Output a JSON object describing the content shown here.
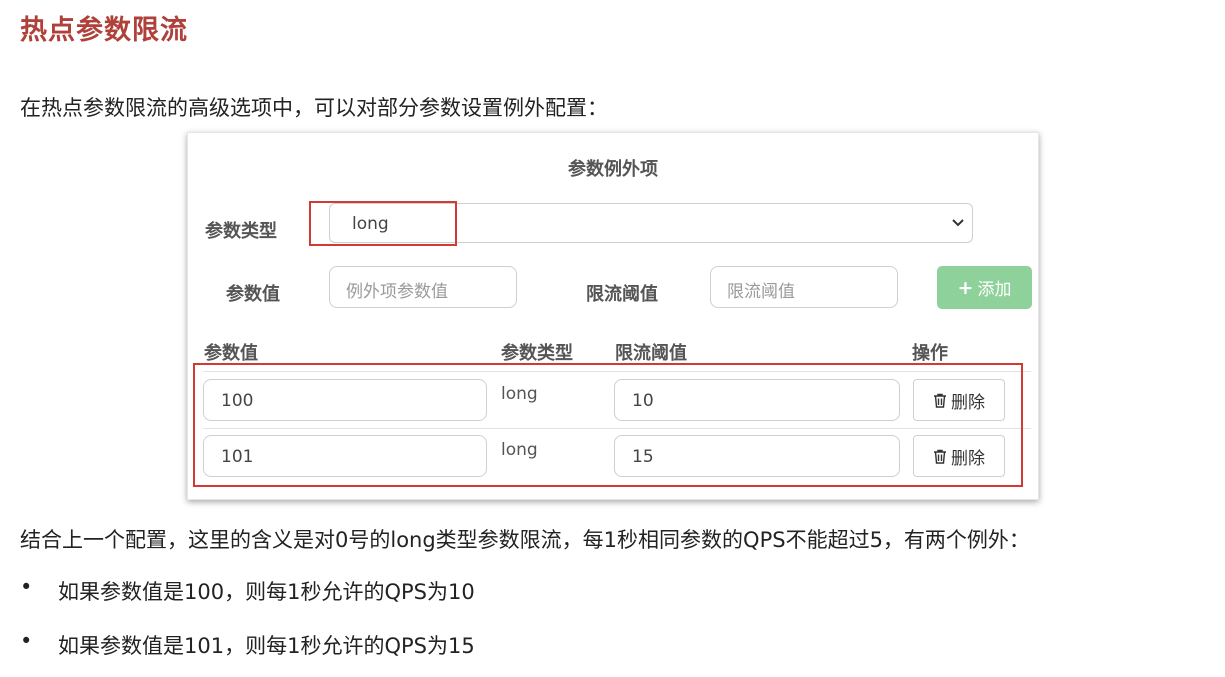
{
  "heading": "热点参数限流",
  "intro": "在热点参数限流的高级选项中，可以对部分参数设置例外配置：",
  "panel": {
    "title": "参数例外项",
    "param_type_label": "参数类型",
    "param_type_value": "long",
    "param_value_label": "参数值",
    "param_value_placeholder": "例外项参数值",
    "threshold_label": "限流阈值",
    "threshold_placeholder": "限流阈值",
    "add_button": "添加",
    "table": {
      "headers": [
        "参数值",
        "参数类型",
        "限流阈值",
        "操作"
      ],
      "rows": [
        {
          "value": "100",
          "type": "long",
          "threshold": "10",
          "action": "删除"
        },
        {
          "value": "101",
          "type": "long",
          "threshold": "15",
          "action": "删除"
        }
      ]
    }
  },
  "summary": "结合上一个配置，这里的含义是对0号的long类型参数限流，每1秒相同参数的QPS不能超过5，有两个例外：",
  "bullets": [
    "如果参数值是100，则每1秒允许的QPS为10",
    "如果参数值是101，则每1秒允许的QPS为15"
  ],
  "colors": {
    "heading": "#b0403a",
    "highlight_box": "#d23a34",
    "add_button": "#8fd19a"
  }
}
